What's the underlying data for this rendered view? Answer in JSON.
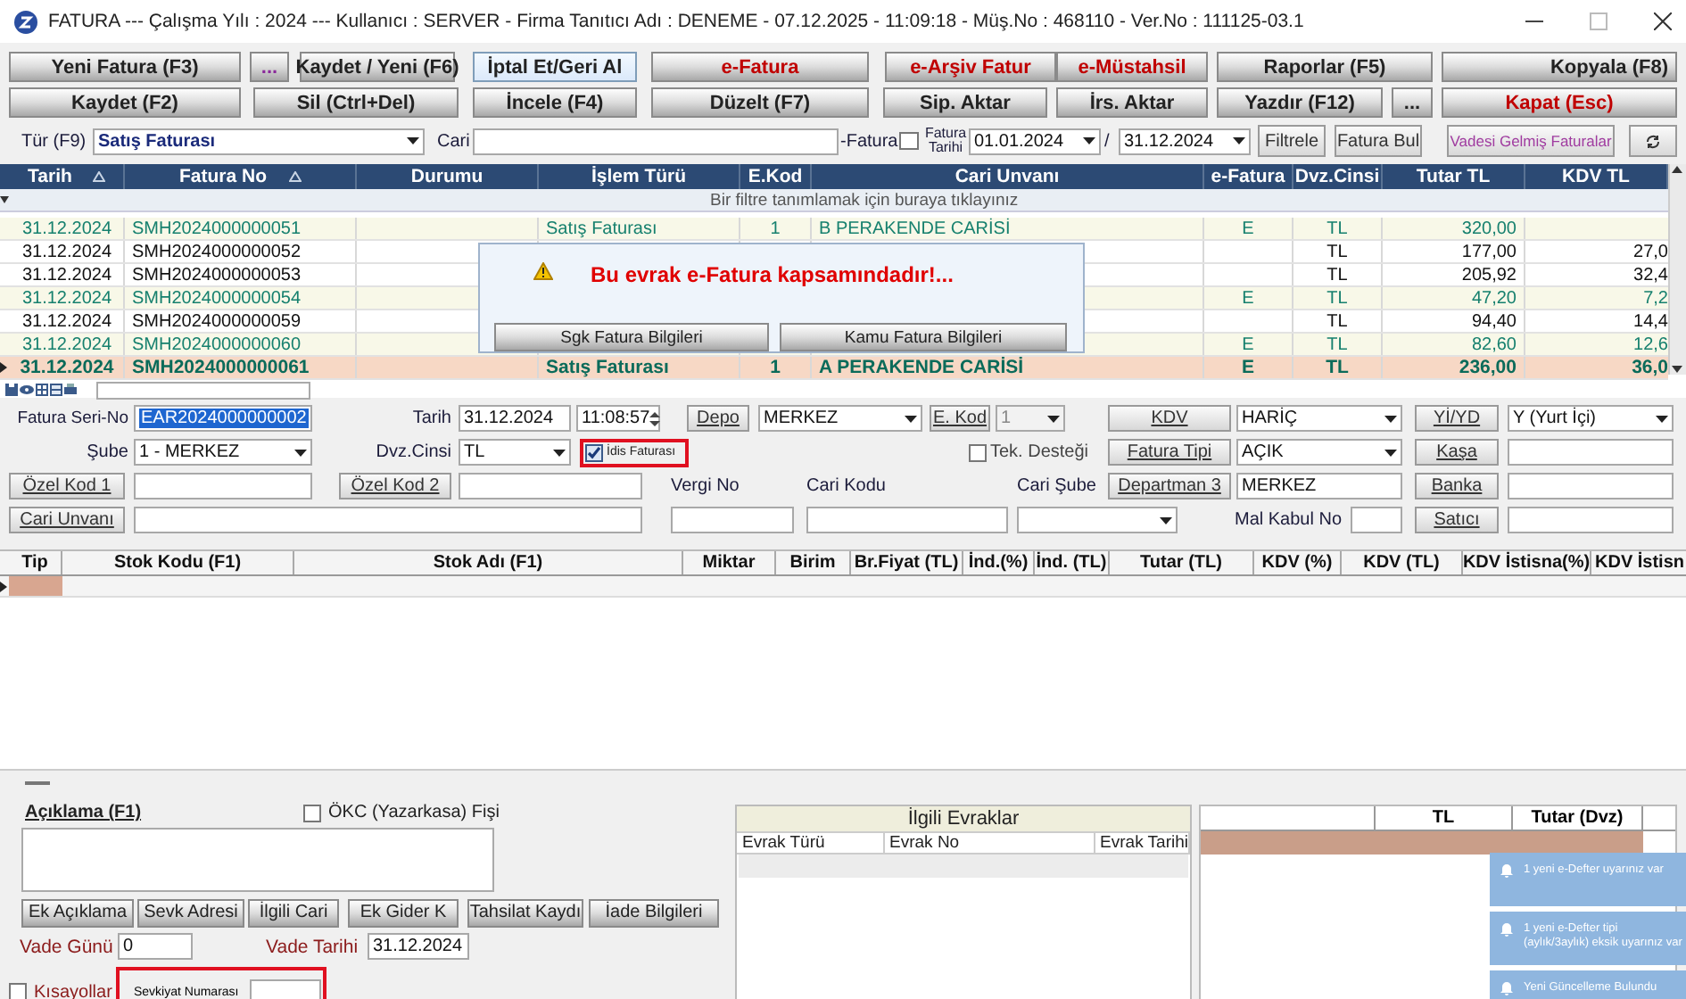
{
  "window": {
    "title": "FATURA --- Çalışma Yılı : 2024 --- Kullanıcı : SERVER - Firma Tanıtıcı Adı : DENEME - 07.12.2025 - 11:09:18 - Müş.No : 468110 - Ver.No : 111125-03.1"
  },
  "toolbar": [
    [
      {
        "label": "Yeni Fatura (F3)",
        "kind": "normal"
      },
      {
        "label": "...",
        "kind": "more"
      },
      {
        "label": "Kaydet / Yeni (F6)",
        "kind": "normal"
      },
      {
        "label": "İptal Et/Geri Al",
        "kind": "highlight"
      },
      {
        "label": "e-Fatura",
        "kind": "red"
      },
      {
        "label": "e-Arşiv Fatur",
        "kind": "red"
      },
      {
        "label": "e-Müstahsil",
        "kind": "red"
      },
      {
        "label": "Raporlar (F5)",
        "kind": "normal"
      },
      {
        "label": "Kopyala (F8)",
        "kind": "right"
      }
    ],
    [
      {
        "label": "Kaydet (F2)",
        "kind": "normal"
      },
      {
        "label": "Sil (Ctrl+Del)",
        "kind": "normal"
      },
      {
        "label": "İncele (F4)",
        "kind": "normal"
      },
      {
        "label": "Düzelt (F7)",
        "kind": "normal"
      },
      {
        "label": "Sip. Aktar",
        "kind": "normal"
      },
      {
        "label": "İrs. Aktar",
        "kind": "normal"
      },
      {
        "label": "Yazdır (F12)",
        "kind": "normal"
      },
      {
        "label": "...",
        "kind": "normal"
      },
      {
        "label": "Kapat (Esc)",
        "kind": "red"
      }
    ]
  ],
  "filter": {
    "type_label": "Tür (F9)",
    "type_value": "Satış Faturası",
    "cari_label": "Cari",
    "efatura_label": "-Fatura",
    "date_filter": {
      "label": "Fatura Tarihi",
      "checked": false
    },
    "date_from": "01.01.2024",
    "separator": "/",
    "date_to": "31.12.2024",
    "buttons": [
      {
        "label": "Filtrele",
        "kind": "normal"
      },
      {
        "label": "Fatura Bul",
        "kind": "normal"
      },
      {
        "label": "Vadesi Gelmiş Faturalar",
        "kind": "purple"
      }
    ]
  },
  "invoices": {
    "columns": [
      {
        "label": "Tarih",
        "sort": true
      },
      {
        "label": "Fatura No",
        "sort": true
      },
      {
        "label": "Durumu",
        "sort": false
      },
      {
        "label": "İşlem Türü",
        "sort": false
      },
      {
        "label": "E.Kod",
        "sort": false
      },
      {
        "label": "Cari Unvanı",
        "sort": false
      },
      {
        "label": "e-Fatura",
        "sort": false
      },
      {
        "label": "Dvz.Cinsi",
        "sort": false
      },
      {
        "label": "Tutar TL",
        "sort": false
      },
      {
        "label": "KDV TL",
        "sort": false
      }
    ],
    "filter_hint": "Bir filtre tanımlamak için buraya tıklayınız",
    "rows": [
      {
        "kind": "e-invoice",
        "selected": false,
        "date": "31.12.2024",
        "number": "SMH2024000000051",
        "type": "Satış Faturası",
        "code": "1",
        "customer": "B PERAKENDE CARİSİ",
        "efatura": "E",
        "currency": "TL",
        "total": "320,00"
      },
      {
        "kind": "standard",
        "selected": false,
        "date": "31.12.2024",
        "number": "SMH2024000000052",
        "currency": "TL",
        "total": "177,00",
        "vat": "27,0"
      },
      {
        "kind": "standard",
        "selected": false,
        "date": "31.12.2024",
        "number": "SMH2024000000053",
        "currency": "TL",
        "total": "205,92",
        "vat": "32,4"
      },
      {
        "kind": "e-invoice",
        "selected": false,
        "date": "31.12.2024",
        "number": "SMH2024000000054",
        "efatura": "E",
        "currency": "TL",
        "total": "47,20",
        "vat": "7,2"
      },
      {
        "kind": "standard",
        "selected": false,
        "date": "31.12.2024",
        "number": "SMH2024000000059",
        "currency": "TL",
        "total": "94,40",
        "vat": "14,4"
      },
      {
        "kind": "e-invoice",
        "selected": false,
        "date": "31.12.2024",
        "number": "SMH2024000000060",
        "efatura": "E",
        "currency": "TL",
        "total": "82,60",
        "vat": "12,6"
      },
      {
        "kind": "e-invoice",
        "selected": true,
        "date": "31.12.2024",
        "number": "SMH2024000000061",
        "type": "Satış Faturası",
        "code": "1",
        "customer": "A PERAKENDE CARİSİ",
        "efatura": "E",
        "currency": "TL",
        "total": "236,00",
        "vat": "36,0"
      }
    ]
  },
  "dialog": {
    "message": "Bu evrak e-Fatura kapsamındadır!...",
    "buttons": [
      "Sgk Fatura Bilgileri",
      "Kamu Fatura Bilgileri"
    ]
  },
  "form": {
    "serial_label": "Fatura Seri-No",
    "serial_value": "EAR2024000000002",
    "date_label": "Tarih",
    "date_value": "31.12.2024",
    "time_value": "11:08:57",
    "depot_button": "Depo",
    "depot_value": "MERKEZ",
    "ecode_button": "E. Kod",
    "ecode_value": "1",
    "kdv_button": "KDV",
    "kdv_value": "HARİÇ",
    "yiyd_button": "Yİ/YD",
    "yiyd_value": "Y (Yurt İçi)",
    "branch_label": "Şube",
    "branch_value": "1 - MERKEZ",
    "currency_label": "Dvz.Cinsi",
    "currency_value": "TL",
    "idis": {
      "label": "İdis Faturası",
      "checked": true,
      "highlighted": true
    },
    "tech": {
      "label": "Tek. Desteği",
      "checked": false
    },
    "type_button": "Fatura Tipi",
    "type_value": "AÇIK",
    "cash_button": "Kaşa",
    "special1_button": "Özel Kod 1",
    "special2_button": "Özel Kod 2",
    "tax_label": "Vergi No",
    "cari_code_label": "Cari Kodu",
    "cari_branch_label": "Cari Şube",
    "dept_button": "Departman 3",
    "dept_value": "MERKEZ",
    "bank_button": "Banka",
    "cari_title_button": "Cari Unvanı",
    "acceptance_label": "Mal Kabul No",
    "seller_button": "Satıcı"
  },
  "lines": {
    "columns": [
      "Tip",
      "Stok Kodu (F1)",
      "Stok Adı (F1)",
      "Miktar",
      "Birim",
      "Br.Fiyat (TL)",
      "İnd.(%)",
      "İnd. (TL)",
      "Tutar (TL)",
      "KDV (%)",
      "KDV (TL)",
      "KDV İstisna(%)",
      "KDV İstisn"
    ]
  },
  "bottom": {
    "note_label": "Açıklama (F1)",
    "okc": {
      "label": "ÖKC (Yazarkasa) Fişi",
      "checked": false
    },
    "buttons": [
      "Ek Açıklama",
      "Sevk Adresi",
      "İlgili Cari",
      "Ek Gider K",
      "Tahsilat Kaydı",
      "İade Bilgileri"
    ],
    "due_days_label": "Vade Günü",
    "due_days_value": "0",
    "due_date_label": "Vade Tarihi",
    "due_date_value": "31.12.2024",
    "shortcuts": {
      "label": "Kısayollar",
      "checked": false
    },
    "shipment": {
      "label": "Sevkiyat Numarası",
      "highlighted": true
    }
  },
  "related": {
    "title": "İlgili Evraklar",
    "columns": [
      "Evrak Türü",
      "Evrak No",
      "Evrak Tarihi"
    ]
  },
  "totals": {
    "columns": [
      "TL",
      "Tutar (Dvz)"
    ]
  },
  "notifications": [
    {
      "text": "1 yeni e-Defter uyarınız var"
    },
    {
      "text": "1 yeni e-Defter tipi (aylık/3aylık) eksik uyarınız var"
    },
    {
      "text": "Yeni Güncelleme Bulundu"
    }
  ]
}
